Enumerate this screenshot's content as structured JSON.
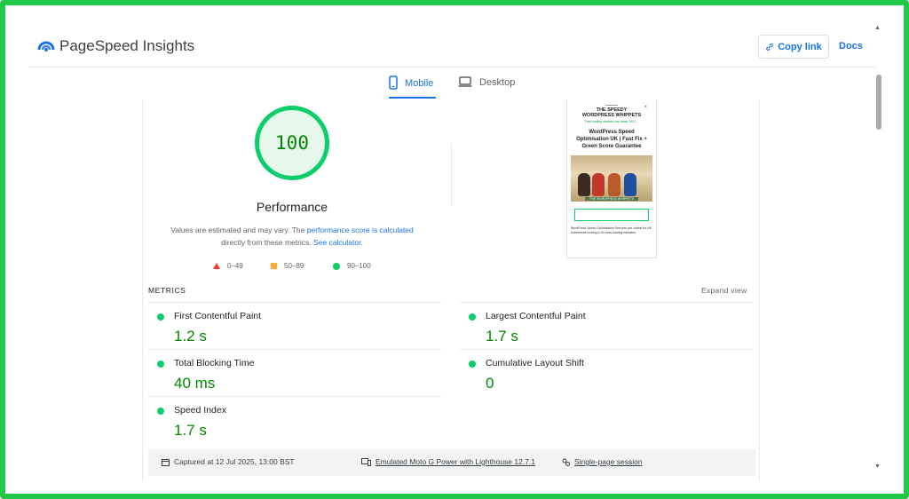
{
  "header": {
    "app_title": "PageSpeed Insights",
    "copy_link_label": "Copy link",
    "docs_label": "Docs"
  },
  "tabs": [
    {
      "label": "Mobile",
      "icon": "phone-icon",
      "selected": true
    },
    {
      "label": "Desktop",
      "icon": "laptop-icon",
      "selected": false
    }
  ],
  "performance": {
    "score": "100",
    "title": "Performance",
    "note_prefix": "Values are estimated and may vary. The ",
    "note_link1": "performance score is calculated",
    "note_middle": " directly from these metrics. ",
    "note_link2": "See calculator.",
    "legend": [
      {
        "range": "0–49",
        "shape": "triangle",
        "color": "#ff3333"
      },
      {
        "range": "50–89",
        "shape": "square",
        "color": "#ffaa33"
      },
      {
        "range": "90–100",
        "shape": "circle",
        "color": "#0cce6b"
      }
    ]
  },
  "thumbnail": {
    "brand": "THE SPEEDY\nWORDPRESS WHIPPETS",
    "tagline": "Fast loading website has better SEO...",
    "heading": "WordPress Speed Optimisation UK | Fast Fix + Green Score Guarantee",
    "caption": "THE WORDPRESS WHIPPETS",
    "footer_text": "WordPress Speed Optimisation Services are critical for UK businesses looking to fix slow-loading websites."
  },
  "metrics": {
    "section_label": "METRICS",
    "expand_label": "Expand view",
    "items": [
      {
        "name": "First Contentful Paint",
        "value": "1.2 s"
      },
      {
        "name": "Largest Contentful Paint",
        "value": "1.7 s"
      },
      {
        "name": "Total Blocking Time",
        "value": "40 ms"
      },
      {
        "name": "Cumulative Layout Shift",
        "value": "0"
      },
      {
        "name": "Speed Index",
        "value": "1.7 s"
      }
    ]
  },
  "footer": {
    "captured": "Captured at 12 Jul 2025, 13:00 BST",
    "emulated": "Emulated Moto G Power with Lighthouse 12.7.1",
    "session": "Single-page session"
  },
  "colors": {
    "accent": "#1a73e8",
    "pass": "#0cce6b",
    "pass_text": "#008800",
    "frame": "#22c84a"
  }
}
